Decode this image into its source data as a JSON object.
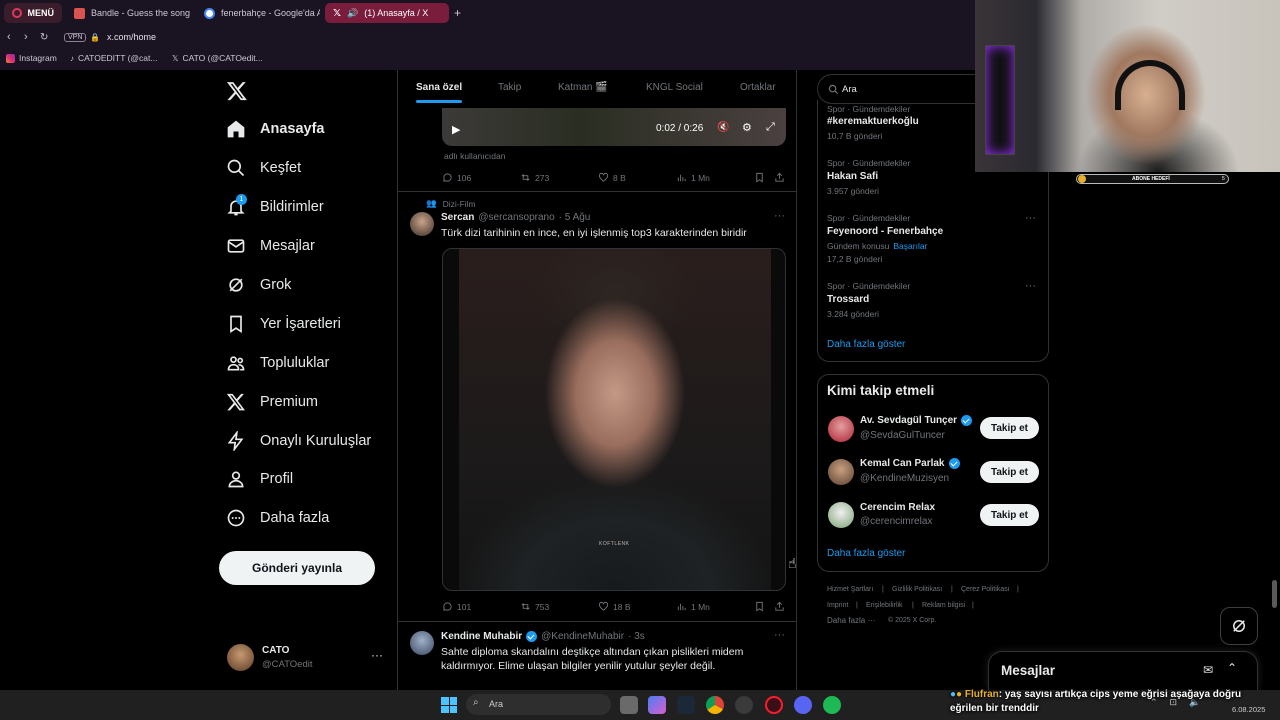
{
  "browser": {
    "menu_label": "MENÜ",
    "tabs": [
      {
        "title": "Bandle - Guess the song..."
      },
      {
        "title": "fenerbahçe - Google'da A"
      },
      {
        "title": "(1) Anasayfa / X"
      }
    ],
    "url": "x.com/home",
    "vpn_label": "VPN",
    "bookmarks": [
      "Instagram",
      "CATOEDITT (@cat...",
      "CATO (@CATOedit..."
    ]
  },
  "nav": {
    "items": [
      {
        "label": "Anasayfa",
        "icon": "home-icon"
      },
      {
        "label": "Keşfet",
        "icon": "search-icon"
      },
      {
        "label": "Bildirimler",
        "icon": "bell-icon"
      },
      {
        "label": "Mesajlar",
        "icon": "mail-icon"
      },
      {
        "label": "Grok",
        "icon": "grok-icon"
      },
      {
        "label": "Yer İşaretleri",
        "icon": "bookmark-icon"
      },
      {
        "label": "Topluluklar",
        "icon": "people-icon"
      },
      {
        "label": "Premium",
        "icon": "x-logo-icon"
      },
      {
        "label": "Onaylı Kuruluşlar",
        "icon": "lightning-icon"
      },
      {
        "label": "Profil",
        "icon": "user-icon"
      },
      {
        "label": "Daha fazla",
        "icon": "more-circle-icon"
      }
    ],
    "notification_badge": "1",
    "post_button": "Gönderi yayınla",
    "account": {
      "name": "CATO",
      "handle": "@CATOedit"
    }
  },
  "timeline": {
    "tabs": [
      "Sana özel",
      "Takip",
      "Katman 🎬",
      "KNGL Social",
      "Ortaklar"
    ],
    "video1": {
      "time": "0:02 / 0:26",
      "caption": "adlı kullanıcıdan"
    },
    "actions1": {
      "replies": "106",
      "reposts": "273",
      "likes": "8 B",
      "views": "1 Mn"
    },
    "tweet2": {
      "community": "Dizi-Film",
      "name": "Sercan",
      "handle": "@sercansoprano",
      "time": "· 5 Ağu",
      "text": "Türk dizi tarihinin en ince, en iyi işlenmiş top3 karakterinden biridir",
      "watermark": "KOFTLENK",
      "actions": {
        "replies": "101",
        "reposts": "753",
        "likes": "18 B",
        "views": "1 Mn"
      }
    },
    "tweet3": {
      "name": "Kendine Muhabir",
      "handle": "@KendineMuhabir",
      "time": "· 3s",
      "text": "Sahte diploma skandalını deştikçe altından çıkan pislikleri midem kaldırmıyor. Elime ulaşan bilgiler yenilir yutulur şeyler değil."
    }
  },
  "right": {
    "search_placeholder": "Ara",
    "trends": [
      {
        "category": "Spor · Gündemdekiler",
        "name": "#keremaktuerkoğlu",
        "count": "10,7 B gönderi"
      },
      {
        "category": "Spor · Gündemdekiler",
        "name": "Hakan Safi",
        "count": "3.957 gönderi"
      },
      {
        "category": "Spor · Gündemdekiler",
        "name": "Feyenoord - Fenerbahçe",
        "topic_label": "Gündem konusu",
        "topic": "Başarılar",
        "count": "17,2 B gönderi"
      },
      {
        "category": "Spor · Gündemdekiler",
        "name": "Trossard",
        "count": "3.284 gönderi"
      }
    ],
    "trends_more": "Daha fazla göster",
    "wtf_title": "Kimi takip etmeli",
    "wtf": [
      {
        "name": "Av. Sevdagül Tunçer",
        "handle": "@SevdaGulTuncer",
        "verified": true,
        "button": "Takip et"
      },
      {
        "name": "Kemal Can Parlak",
        "handle": "@KendineMuzisyen",
        "verified": true,
        "button": "Takip et"
      },
      {
        "name": "Cerencim Relax",
        "handle": "@cerencimrelax",
        "verified": false,
        "button": "Takip et"
      }
    ],
    "wtf_more": "Daha fazla göster",
    "footer": [
      "Hizmet Şartları",
      "Gizlilik Politikası",
      "Çerez Politikası",
      "Imprint",
      "Erişilebilirlik",
      "Reklam bilgisi",
      "Daha fazla ···",
      "© 2025 X Corp."
    ]
  },
  "messages_drawer": {
    "title": "Mesajlar"
  },
  "stream_overlay": {
    "goal_label": "ABONE HEDEFİ",
    "goal_count": "5",
    "chat_user": "Flufran",
    "chat_text": ": yaş sayısı artıkça cips yeme eğrisi aşağaya doğru eğrilen bir trenddir"
  },
  "taskbar": {
    "search_placeholder": "Ara",
    "date": "6.08.2025"
  }
}
